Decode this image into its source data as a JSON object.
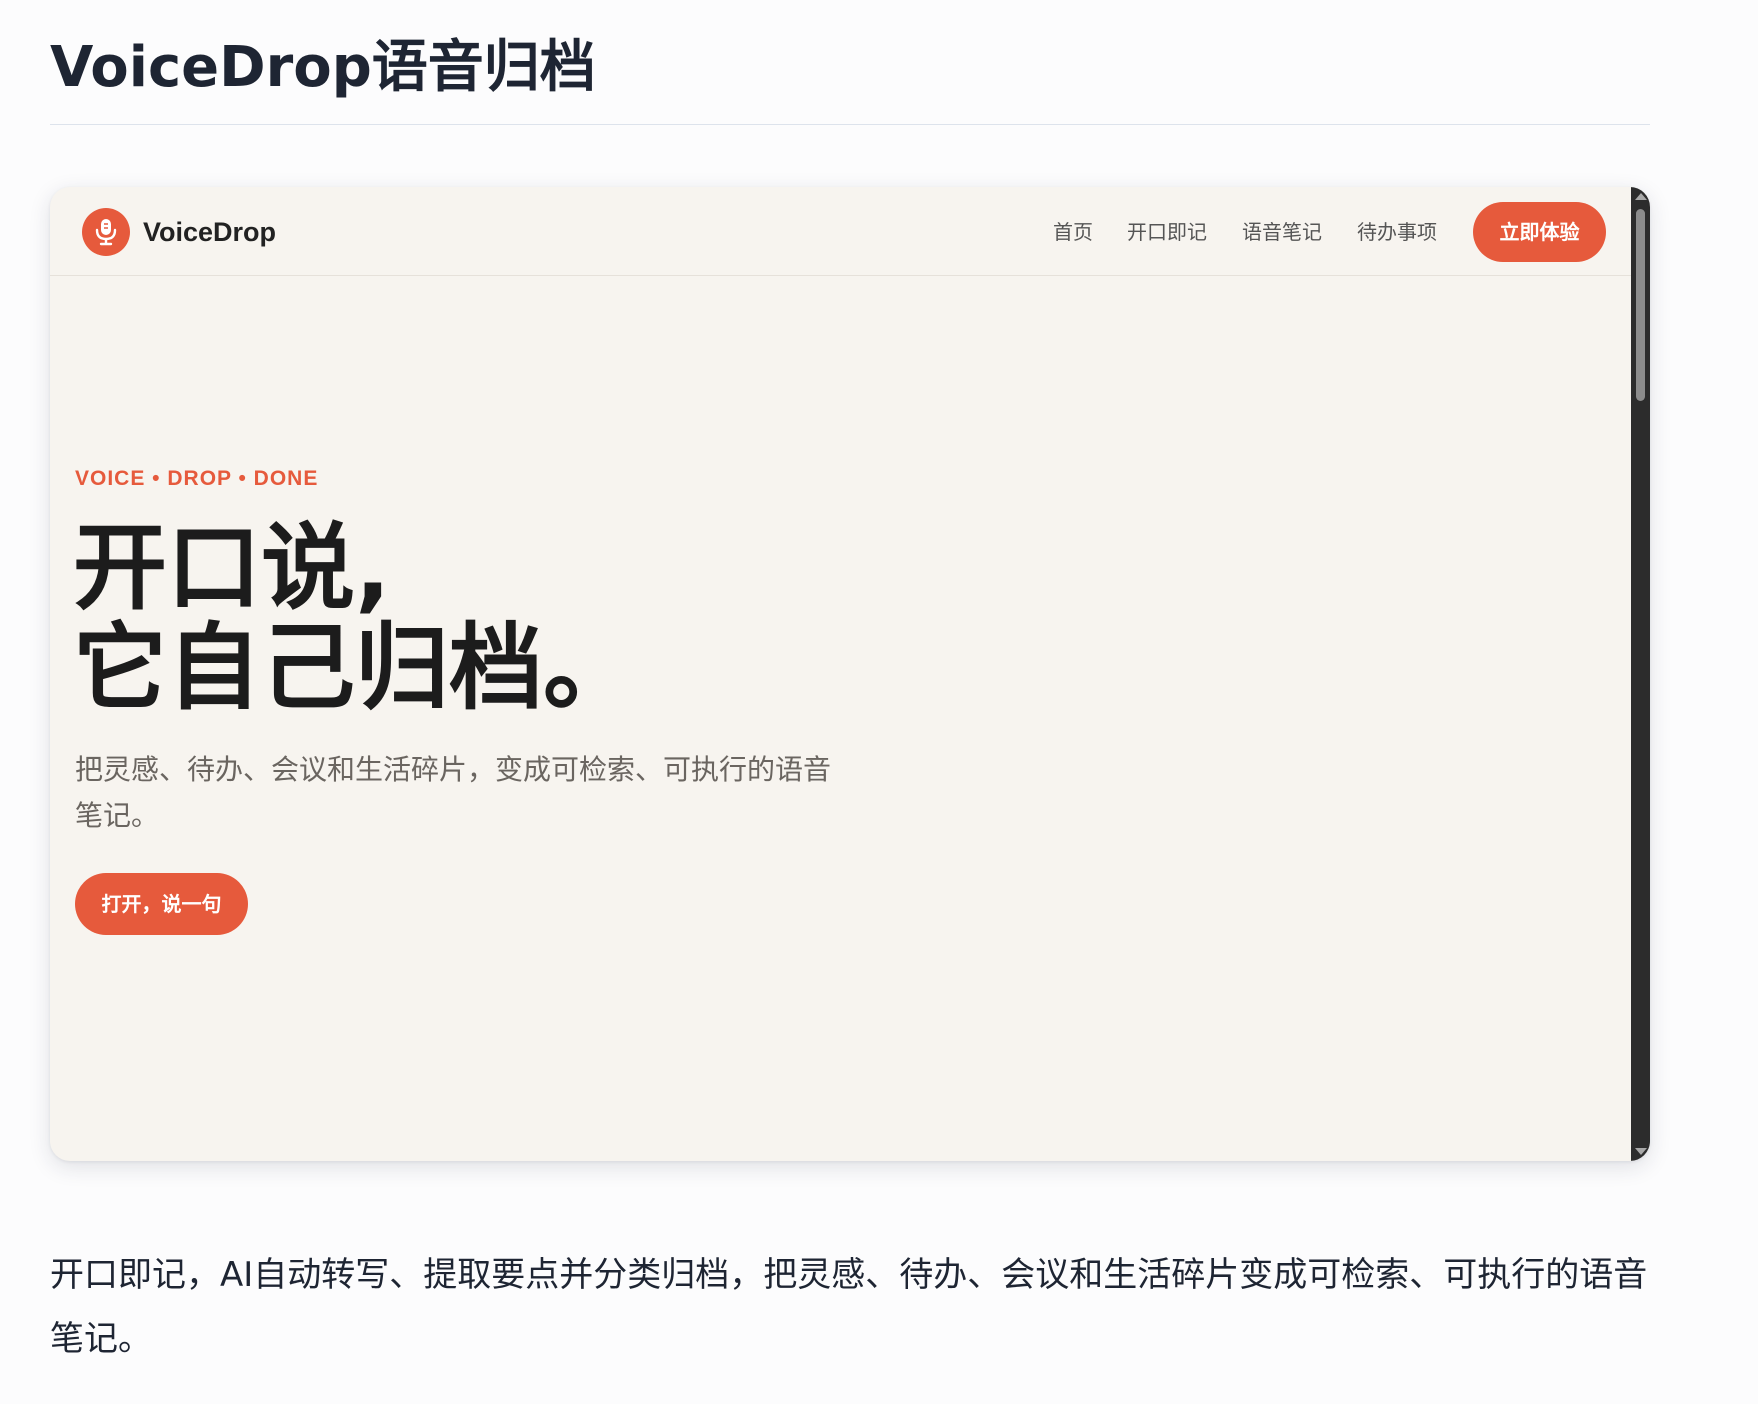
{
  "page": {
    "title": "VoiceDrop语音归档",
    "description": "开口即记，AI自动转写、提取要点并分类归档，把灵感、待办、会议和生活碎片变成可检索、可执行的语音笔记。"
  },
  "preview": {
    "nav": {
      "logo_icon": "microphone-icon",
      "brand": "VoiceDrop",
      "links": [
        "首页",
        "开口即记",
        "语音笔记",
        "待办事项"
      ],
      "cta": "立即体验"
    },
    "hero": {
      "eyebrow": "VOICE • DROP • DONE",
      "headline_line1": "开口说,",
      "headline_line2": "它自己归档。",
      "description": "把灵感、待办、会议和生活碎片，变成可检索、可执行的语音笔记。",
      "cta": "打开，说一句"
    }
  },
  "colors": {
    "accent": "#e65a3c",
    "preview_background": "#f7f4ef",
    "page_background": "#fcfcfd",
    "text_dark": "#1e2533",
    "scrollbar": "#2c2c2c"
  }
}
